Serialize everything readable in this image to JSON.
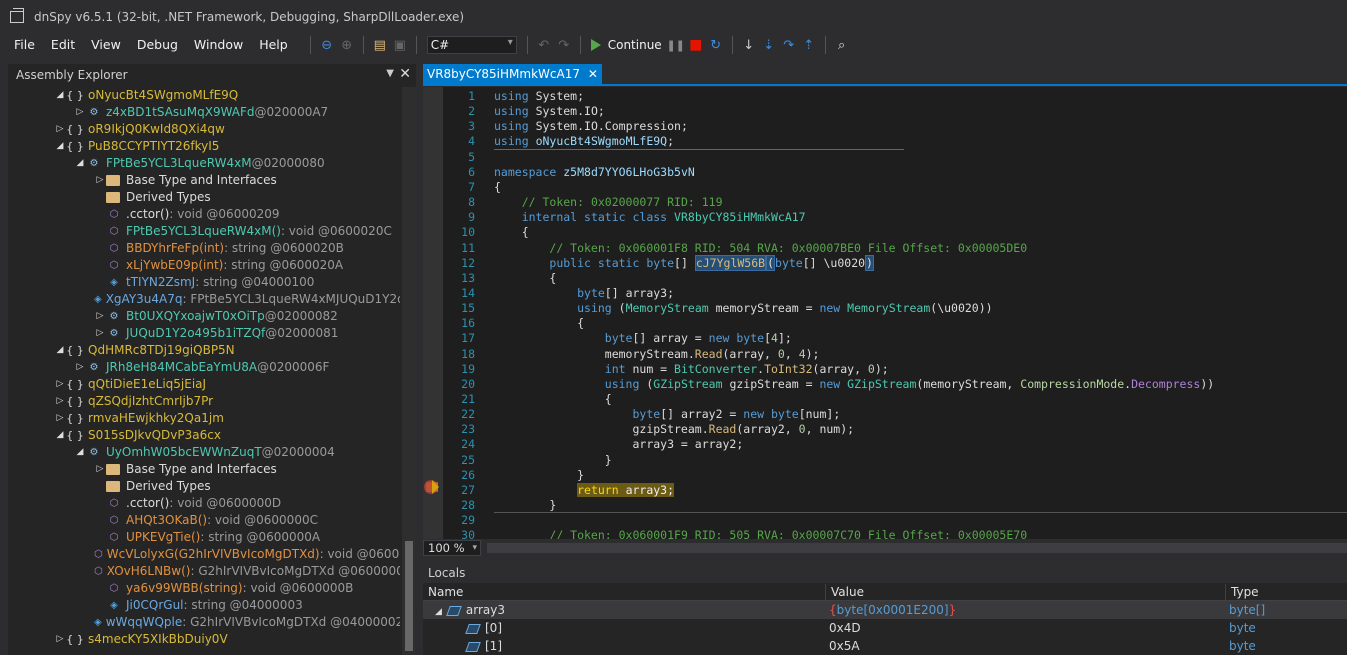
{
  "window": {
    "title": "dnSpy v6.5.1 (32-bit, .NET Framework, Debugging, SharpDllLoader.exe)"
  },
  "menu": [
    "File",
    "Edit",
    "View",
    "Debug",
    "Window",
    "Help"
  ],
  "toolbar": {
    "language": "C#",
    "continue_label": "Continue"
  },
  "explorer": {
    "title": "Assembly Explorer",
    "nodes": [
      {
        "text": "oNyucBt4SWgmoMLfE9Q",
        "extra": ""
      },
      {
        "text": "z4xBD1tSAsuMqX9WAFd",
        "extra": " @020000A7"
      },
      {
        "text": "oR9IkjQ0KwId8QXi4qw",
        "extra": ""
      },
      {
        "text": "PuB8CCYPTIYT26fkyI5",
        "extra": ""
      },
      {
        "text": "FPtBe5YCL3LqueRW4xM",
        "extra": " @02000080"
      },
      {
        "text": "Base Type and Interfaces",
        "extra": ""
      },
      {
        "text": "Derived Types",
        "extra": ""
      },
      {
        "text": ".cctor()",
        "extra": " : void @06000209"
      },
      {
        "text": "FPtBe5YCL3LqueRW4xM()",
        "extra": " : void @0600020C"
      },
      {
        "text": "BBDYhrFeFp(int)",
        "extra": " : string @0600020B"
      },
      {
        "text": "xLjYwbE09p(int)",
        "extra": " : string @0600020A"
      },
      {
        "text": "tTIYN2ZsmJ",
        "extra": " : string @04000100"
      },
      {
        "text": "XgAY3u4A7q",
        "extra": " : FPtBe5YCL3LqueRW4xMJUQuD1Y2o"
      },
      {
        "text": "Bt0UXQYxoajwT0xOiTp",
        "extra": " @02000082"
      },
      {
        "text": "JUQuD1Y2o495b1iTZQf",
        "extra": " @02000081"
      },
      {
        "text": "QdHMRc8TDj19giQBP5N",
        "extra": ""
      },
      {
        "text": "JRh8eH84MCabEaYmU8A",
        "extra": " @0200006F"
      },
      {
        "text": "qQtiDieE1eLiq5jEiaJ",
        "extra": ""
      },
      {
        "text": "qZSQdjIzhtCmrIjb7Pr",
        "extra": ""
      },
      {
        "text": "rmvaHEwjkhky2Qa1jm",
        "extra": ""
      },
      {
        "text": "S015sDJkvQDvP3a6cx",
        "extra": ""
      },
      {
        "text": "UyOmhW05bcEWWnZuqT",
        "extra": " @02000004"
      },
      {
        "text": "Base Type and Interfaces",
        "extra": ""
      },
      {
        "text": "Derived Types",
        "extra": ""
      },
      {
        "text": ".cctor()",
        "extra": " : void @0600000D"
      },
      {
        "text": "AHQt3OKaB()",
        "extra": " : void @0600000C"
      },
      {
        "text": "UPKEVgTie()",
        "extra": " : string @0600000A"
      },
      {
        "text": "WcVLolyxG(G2hIrVIVBvIcoMgDTXd)",
        "extra": " : void @0600000"
      },
      {
        "text": "XOvH6LNBw()",
        "extra": " : G2hIrVIVBvIcoMgDTXd @06000008"
      },
      {
        "text": "ya6v99WBB(string)",
        "extra": " : void @0600000B"
      },
      {
        "text": "Ji0CQrGul",
        "extra": " : string @04000003"
      },
      {
        "text": "wWqqWQple",
        "extra": " : G2hIrVIVBvIcoMgDTXd @04000002"
      },
      {
        "text": "s4mecKY5XIkBbDuiy0V",
        "extra": ""
      }
    ]
  },
  "editor": {
    "tab_title": "VR8byCY85iHMmkWcA17",
    "zoom": "100 %",
    "lines": [
      {
        "n": "1"
      },
      {
        "n": "2"
      },
      {
        "n": "3"
      },
      {
        "n": "4"
      },
      {
        "n": "5"
      },
      {
        "n": "6"
      },
      {
        "n": "7"
      },
      {
        "n": "8"
      },
      {
        "n": "9"
      },
      {
        "n": "10"
      },
      {
        "n": "11"
      },
      {
        "n": "12"
      },
      {
        "n": "13"
      },
      {
        "n": "14"
      },
      {
        "n": "15"
      },
      {
        "n": "16"
      },
      {
        "n": "17"
      },
      {
        "n": "18"
      },
      {
        "n": "19"
      },
      {
        "n": "20"
      },
      {
        "n": "21"
      },
      {
        "n": "22"
      },
      {
        "n": "23"
      },
      {
        "n": "24"
      },
      {
        "n": "25"
      },
      {
        "n": "26"
      },
      {
        "n": "27"
      },
      {
        "n": "28"
      },
      {
        "n": "29"
      },
      {
        "n": "30"
      }
    ],
    "code": {
      "l1": "System",
      "l2": "System.IO",
      "l3": "System.IO.Compression",
      "l4": "oNyucBt4SWgmoMLfE9Q",
      "l6": "z5M8d7YYO6LHoG3b5vN",
      "l8": "// Token: 0x02000077 RID: 119",
      "l9_class": "VR8byCY85iHMmkWcA17",
      "l11": "// Token: 0x060001F8 RID: 504 RVA: 0x00007BE0 File Offset: 0x00005DE0",
      "l12_method": "cJ7YglW56B",
      "l12_param": "\\u0020",
      "l30": "// Token: 0x060001F9 RID: 505 RVA: 0x00007C70 File Offset: 0x00005E70"
    }
  },
  "locals": {
    "title": "Locals",
    "columns": [
      "Name",
      "Value",
      "Type"
    ],
    "rows": [
      {
        "name": "array3",
        "value_prefix": "{",
        "value": "byte[0x0001E200]",
        "value_suffix": "}",
        "type": "byte[]"
      },
      {
        "name": "[0]",
        "value": "0x4D",
        "type": "byte"
      },
      {
        "name": "[1]",
        "value": "0x5A",
        "type": "byte"
      }
    ]
  },
  "colors": {
    "accent": "#007acc",
    "background": "#1e1e1e",
    "current_line": "#c8c815"
  }
}
